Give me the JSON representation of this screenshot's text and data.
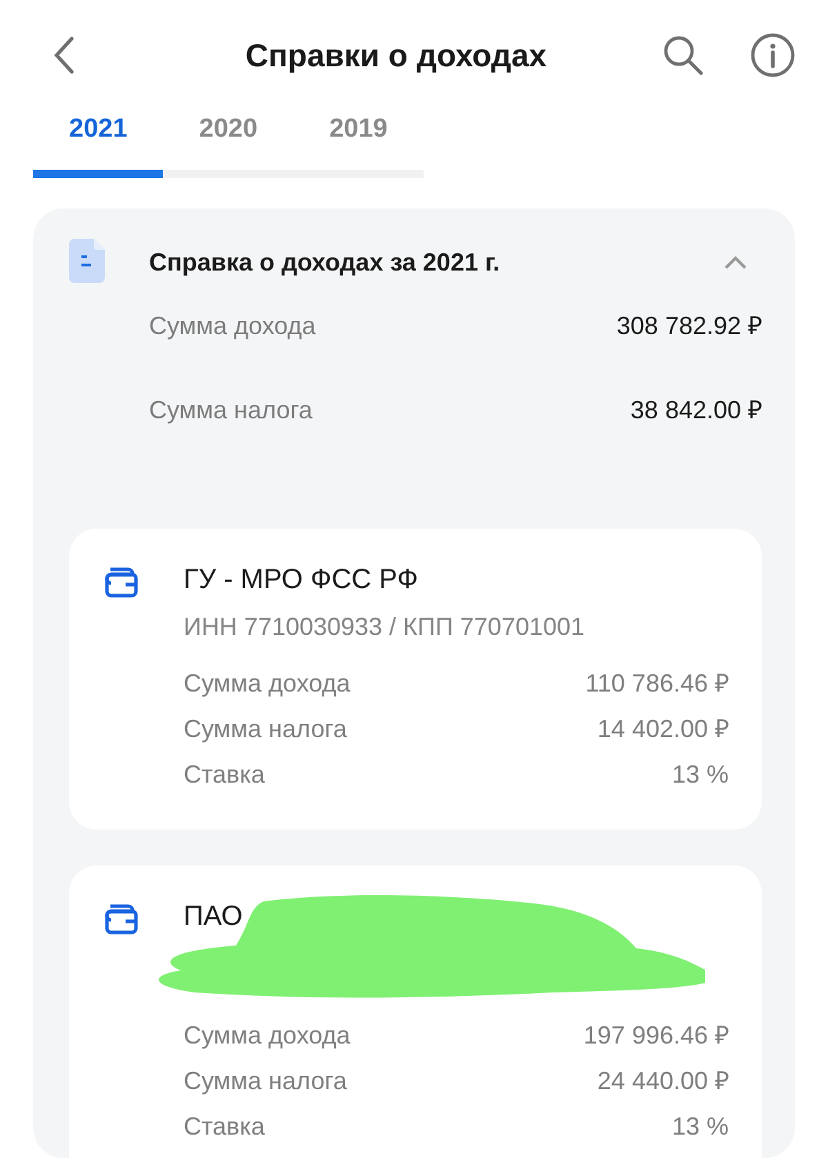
{
  "header": {
    "title": "Справки о доходах"
  },
  "tabs": [
    {
      "label": "2021",
      "selected": true
    },
    {
      "label": "2020",
      "selected": false
    },
    {
      "label": "2019",
      "selected": false
    }
  ],
  "summary": {
    "title": "Справка о доходах за 2021 г.",
    "expanded": true,
    "rows": [
      {
        "label": "Сумма дохода",
        "value": "308 782.92 ₽"
      },
      {
        "label": "Сумма налога",
        "value": "38 842.00 ₽"
      }
    ]
  },
  "employers": [
    {
      "name": "ГУ - МРО ФСС РФ",
      "details": "ИНН 7710030933 / КПП 770701001",
      "redacted": false,
      "rows": [
        {
          "label": "Сумма дохода",
          "value": "110 786.46 ₽"
        },
        {
          "label": "Сумма налога",
          "value": "14 402.00 ₽"
        },
        {
          "label": "Ставка",
          "value": "13 %"
        }
      ]
    },
    {
      "name": "ПАО",
      "redacted": true,
      "rows": [
        {
          "label": "Сумма дохода",
          "value": "197 996.46 ₽"
        },
        {
          "label": "Сумма налога",
          "value": "24 440.00 ₽"
        },
        {
          "label": "Ставка",
          "value": "13 %"
        }
      ]
    }
  ]
}
